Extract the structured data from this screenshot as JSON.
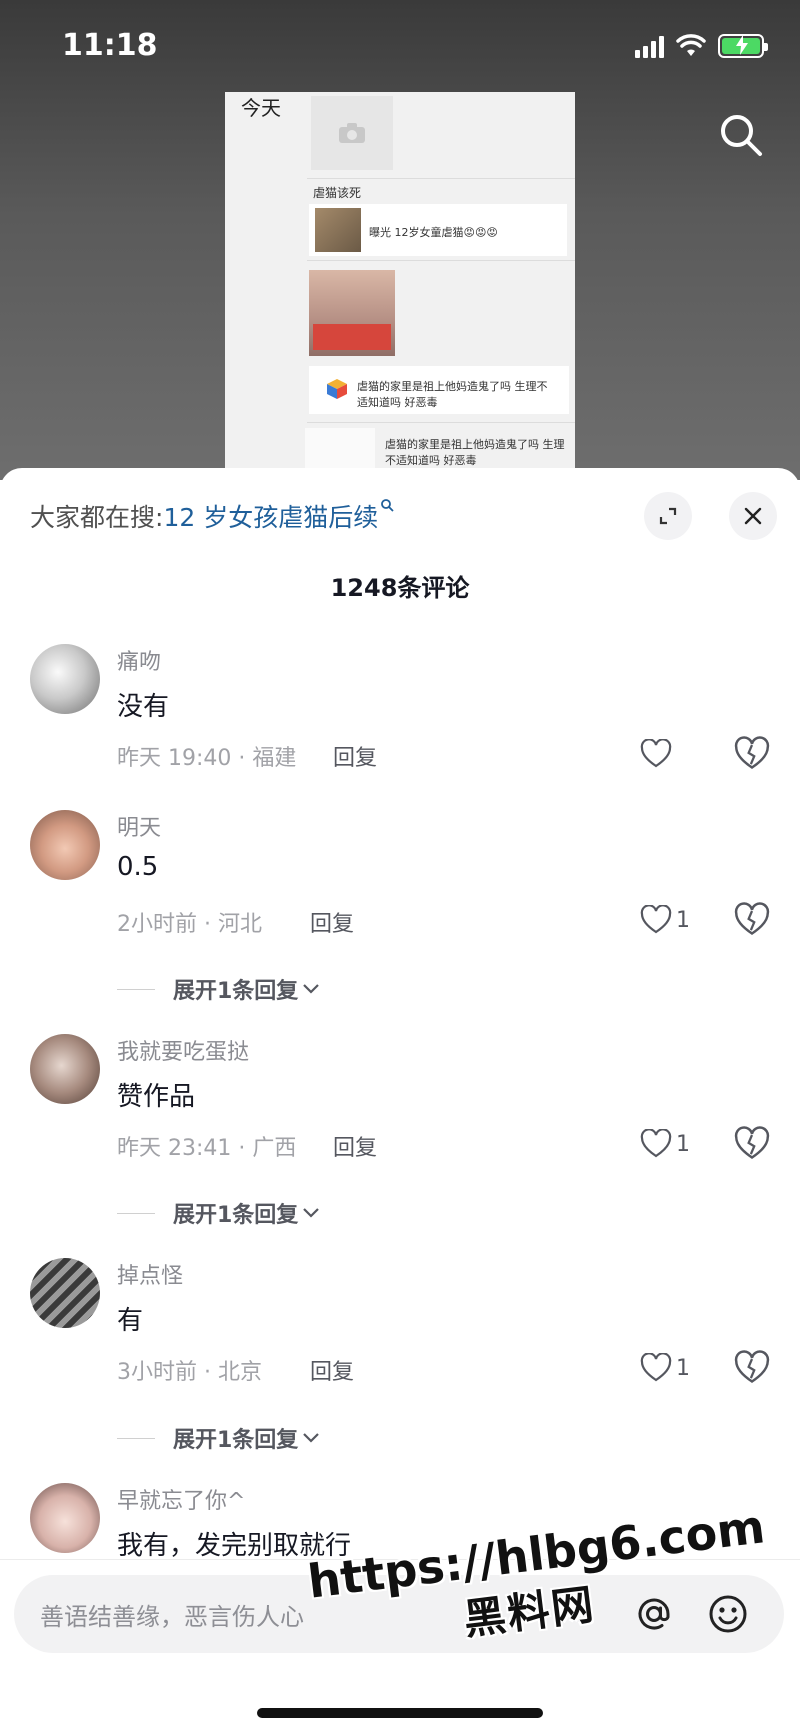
{
  "status_bar": {
    "time": "11:18"
  },
  "video": {
    "frame_today": "今天",
    "frame_label_1": "虐猫该死",
    "frame_share_1": "曝光 12岁女童虐猫😡😡😡",
    "frame_msg_1": "虐猫的家里是祖上他妈造鬼了吗 生理不",
    "frame_msg_1b": "适知道吗 好恶毒",
    "frame_msg_2": "虐猫的家里是祖上他妈造鬼了吗 生理",
    "frame_msg_2b": "不适知道吗 好恶毒"
  },
  "sheet": {
    "hot_search_prefix": "大家都在搜:",
    "hot_search_term": "12 岁女孩虐猫后续",
    "comment_count": "1248条评论",
    "reply_label": "回复"
  },
  "comments": [
    {
      "user": "痛吻",
      "text": "没有",
      "meta": "昨天 19:40 · 福建",
      "likes": ""
    },
    {
      "user": "明天",
      "text": "0.5",
      "meta": "2小时前 · 河北",
      "likes": "1",
      "expand": "展开1条回复"
    },
    {
      "user": "我就要吃蛋挞",
      "text": "赞作品",
      "meta": "昨天 23:41 · 广西",
      "likes": "1",
      "expand": "展开1条回复"
    },
    {
      "user": "掉点怪",
      "text": "有",
      "meta": "3小时前 · 北京",
      "likes": "1",
      "expand": "展开1条回复"
    },
    {
      "user": "早就忘了你^",
      "text": "我有，发完别取就行"
    }
  ],
  "input": {
    "placeholder": "善语结善缘，恶言伤人心"
  },
  "watermark": {
    "url": "https://hlbg6.com",
    "name": "黑料网"
  },
  "colors": {
    "accent_link": "#1f5f9a",
    "secondary_text": "#8a8b91",
    "battery_green": "#4cd964"
  }
}
